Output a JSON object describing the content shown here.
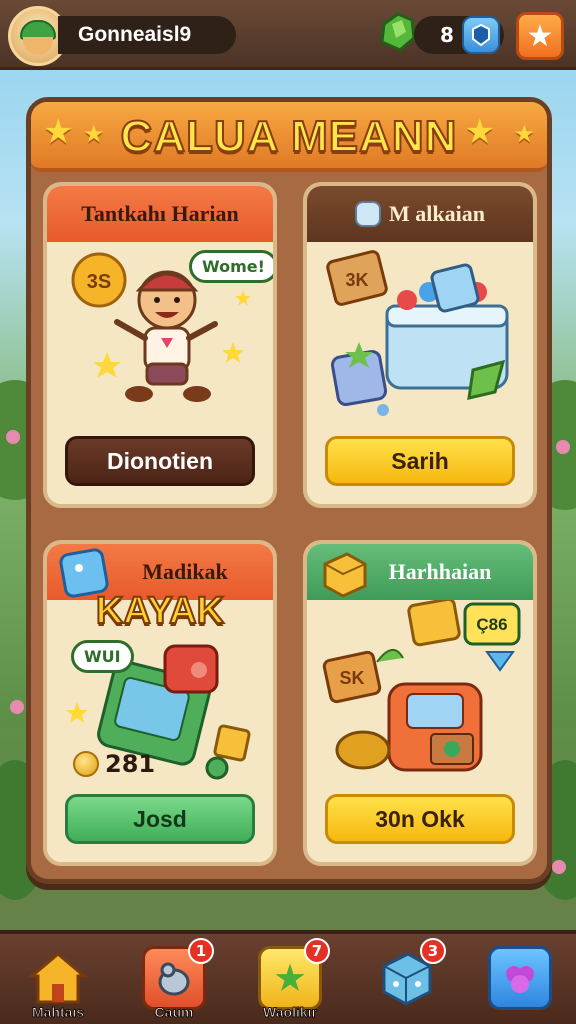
{
  "topbar": {
    "player_name": "Gonneaiѕl9",
    "currency_value": "8",
    "avatar_icon": "frog-hat-avatar-icon",
    "gem_icon": "green-gem-icon",
    "plus_icon": "plus-gem-icon",
    "star_icon": "star-icon"
  },
  "panel": {
    "title": "CALUA MEANN"
  },
  "cards": [
    {
      "header": "Tantkahı Harian",
      "bubble": "Wome!",
      "badge_text": "3S",
      "button": "Dionotien"
    },
    {
      "header": "M alkaian",
      "badge_text": "3K",
      "button": "Sarih"
    },
    {
      "header": "Madikak",
      "promo": "KAYAK",
      "bubble": "WUI",
      "coin_value": "281",
      "button": "Josd"
    },
    {
      "header": "Harhhaian",
      "tag_text": "Ç86",
      "badge_text": "SK",
      "button": "30n Okk"
    }
  ],
  "bottom_nav": [
    {
      "label": "Mahtaıs",
      "badge": ""
    },
    {
      "label": "Caum",
      "badge": "1"
    },
    {
      "label": "Waolikır",
      "badge": "7"
    },
    {
      "label": "",
      "badge": "3"
    },
    {
      "label": "",
      "badge": ""
    }
  ],
  "colors": {
    "accent_orange": "#f0701f",
    "title_yellow": "#ffe64a",
    "panel_brown": "#a86a43"
  }
}
